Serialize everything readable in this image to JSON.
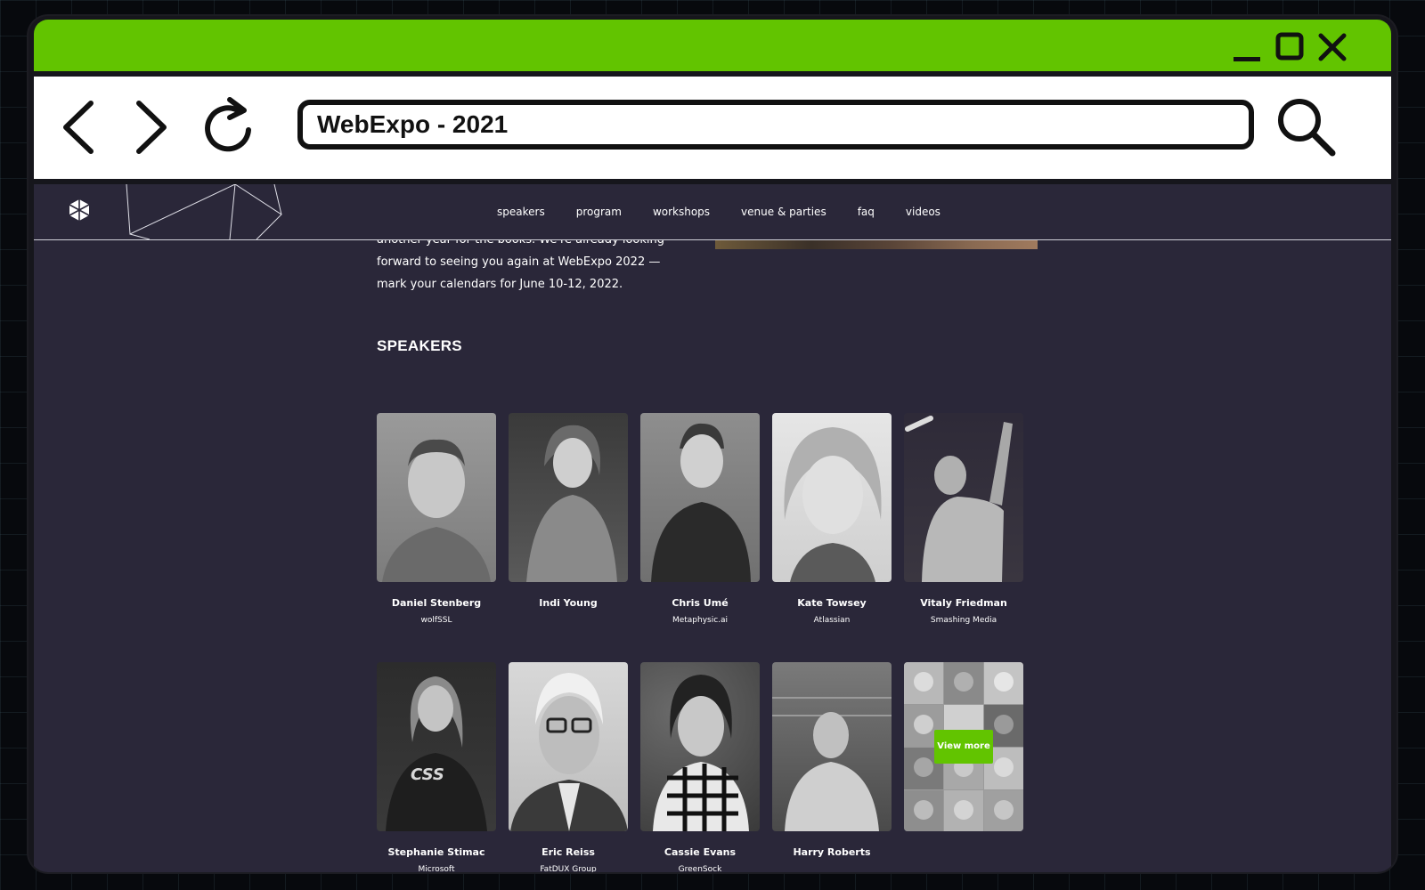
{
  "browser": {
    "url": "WebExpo - 2021"
  },
  "nav": {
    "items": [
      "speakers",
      "program",
      "workshops",
      "venue & parties",
      "faq",
      "videos"
    ]
  },
  "intro": {
    "text": "another year for the books. We're already looking forward to seeing you again at WebExpo 2022 — mark your calendars for June 10-12, 2022."
  },
  "speakers_section": {
    "title": "SPEAKERS",
    "view_more": "View more",
    "speakers": [
      {
        "name": "Daniel Stenberg",
        "company": "wolfSSL"
      },
      {
        "name": "Indi Young",
        "company": ""
      },
      {
        "name": "Chris Umé",
        "company": "Metaphysic.ai"
      },
      {
        "name": "Kate Towsey",
        "company": "Atlassian"
      },
      {
        "name": "Vitaly Friedman",
        "company": "Smashing Media"
      },
      {
        "name": "Stephanie Stimac",
        "company": "Microsoft"
      },
      {
        "name": "Eric Reiss",
        "company": "FatDUX Group"
      },
      {
        "name": "Cassie Evans",
        "company": "GreenSock"
      },
      {
        "name": "Harry Roberts",
        "company": ""
      }
    ]
  },
  "colors": {
    "accent": "#62c400",
    "page_bg": "#2a2739"
  }
}
